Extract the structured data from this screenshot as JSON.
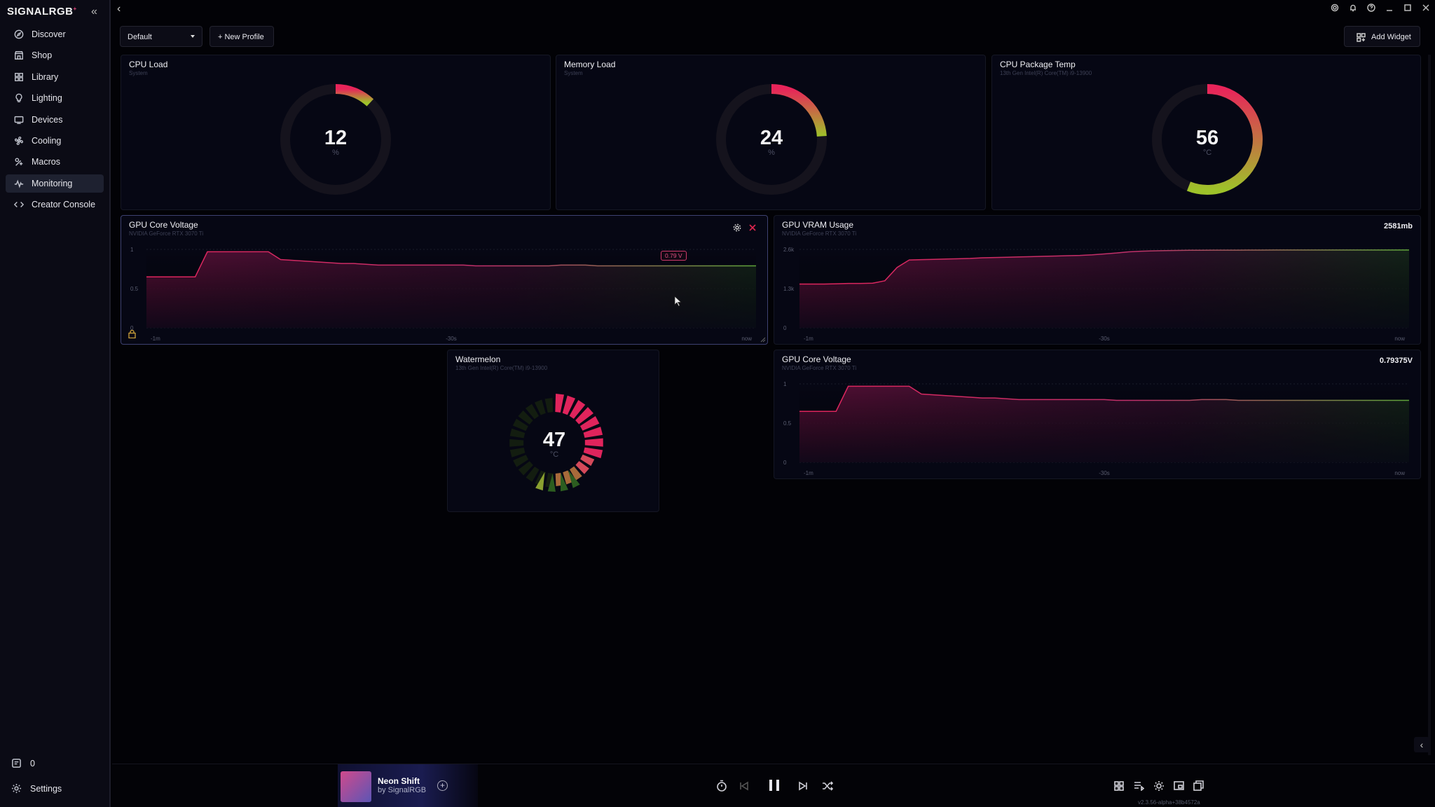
{
  "app": {
    "logo": "SIGNALRGB",
    "nav": [
      {
        "label": "Discover",
        "icon": "compass-icon"
      },
      {
        "label": "Shop",
        "icon": "shop-icon"
      },
      {
        "label": "Library",
        "icon": "library-icon"
      },
      {
        "label": "Lighting",
        "icon": "lightbulb-icon"
      },
      {
        "label": "Devices",
        "icon": "devices-icon"
      },
      {
        "label": "Cooling",
        "icon": "fan-icon"
      },
      {
        "label": "Macros",
        "icon": "macros-icon"
      },
      {
        "label": "Monitoring",
        "icon": "pulse-icon"
      },
      {
        "label": "Creator Console",
        "icon": "code-icon"
      }
    ],
    "active_nav": "Monitoring",
    "notifications_count": "0",
    "settings_label": "Settings"
  },
  "toolbar": {
    "profile": "Default",
    "new_profile": "+ New Profile",
    "add_widget": "Add Widget"
  },
  "widgets": {
    "cpu_load": {
      "title": "CPU Load",
      "subtitle": "System",
      "value": "12",
      "unit": "%",
      "percent": 12,
      "color_from": "#e8245a",
      "color_to": "#9ec22a"
    },
    "memory_load": {
      "title": "Memory Load",
      "subtitle": "System",
      "value": "24",
      "unit": "%",
      "percent": 24,
      "color_from": "#e8245a",
      "color_to": "#9ec22a"
    },
    "cpu_temp": {
      "title": "CPU Package Temp",
      "subtitle": "13th Gen Intel(R) Core(TM) i9-13900",
      "value": "56",
      "unit": "°C",
      "percent": 56,
      "color_from": "#e8245a",
      "color_to": "#9ec22a"
    },
    "gpu_voltage": {
      "title": "GPU Core Voltage",
      "subtitle": "NVIDIA GeForce RTX 3070 Ti",
      "tooltip": "0.79 V",
      "y_ticks": [
        "1",
        "0.5",
        "0"
      ],
      "x_ticks": [
        "-1m",
        "-30s",
        "now"
      ]
    },
    "gpu_vram": {
      "title": "GPU VRAM Usage",
      "subtitle": "NVIDIA GeForce RTX 3070 Ti",
      "value": "2581mb",
      "y_ticks": [
        "2.6k",
        "1.3k",
        "0"
      ],
      "x_ticks": [
        "-1m",
        "-30s",
        "now"
      ]
    },
    "watermelon": {
      "title": "Watermelon",
      "subtitle": "13th Gen Intel(R) Core(TM) i9-13900",
      "value": "47",
      "unit": "°C",
      "percent": 47
    },
    "gpu_voltage2": {
      "title": "GPU Core Voltage",
      "subtitle": "NVIDIA GeForce RTX 3070 Ti",
      "value": "0.79375V",
      "y_ticks": [
        "1",
        "0.5",
        "0"
      ],
      "x_ticks": [
        "-1m",
        "-30s",
        "now"
      ]
    }
  },
  "chart_data": [
    {
      "type": "line",
      "title": "GPU Core Voltage",
      "ylim": [
        0,
        1
      ],
      "x": [
        "-1m",
        "-30s",
        "now"
      ],
      "values": [
        0.65,
        0.65,
        0.65,
        0.65,
        0.65,
        0.97,
        0.97,
        0.97,
        0.97,
        0.97,
        0.97,
        0.87,
        0.86,
        0.85,
        0.84,
        0.83,
        0.82,
        0.82,
        0.81,
        0.8,
        0.8,
        0.8,
        0.8,
        0.8,
        0.8,
        0.8,
        0.8,
        0.79,
        0.79,
        0.79,
        0.79,
        0.79,
        0.79,
        0.79,
        0.8,
        0.8,
        0.8,
        0.79,
        0.79,
        0.79,
        0.79,
        0.79,
        0.79,
        0.79,
        0.79,
        0.79,
        0.79,
        0.79,
        0.79,
        0.79,
        0.79
      ]
    },
    {
      "type": "line",
      "title": "GPU VRAM Usage",
      "ylim": [
        0,
        2600
      ],
      "x": [
        "-1m",
        "-30s",
        "now"
      ],
      "values": [
        1450,
        1450,
        1450,
        1460,
        1470,
        1470,
        1480,
        1560,
        2000,
        2250,
        2260,
        2270,
        2280,
        2290,
        2300,
        2320,
        2330,
        2340,
        2350,
        2360,
        2370,
        2380,
        2390,
        2400,
        2420,
        2450,
        2480,
        2520,
        2540,
        2550,
        2560,
        2565,
        2570,
        2570,
        2575,
        2575,
        2575,
        2578,
        2578,
        2580,
        2580,
        2580,
        2580,
        2580,
        2581,
        2581,
        2581,
        2581,
        2581,
        2581,
        2581
      ]
    },
    {
      "type": "line",
      "title": "GPU Core Voltage",
      "ylim": [
        0,
        1
      ],
      "x": [
        "-1m",
        "-30s",
        "now"
      ],
      "values": [
        0.65,
        0.65,
        0.65,
        0.65,
        0.97,
        0.97,
        0.97,
        0.97,
        0.97,
        0.97,
        0.87,
        0.86,
        0.85,
        0.84,
        0.83,
        0.82,
        0.82,
        0.81,
        0.8,
        0.8,
        0.8,
        0.8,
        0.8,
        0.8,
        0.8,
        0.8,
        0.79,
        0.79,
        0.79,
        0.79,
        0.79,
        0.79,
        0.79,
        0.8,
        0.8,
        0.8,
        0.79,
        0.79,
        0.79,
        0.79,
        0.79,
        0.79,
        0.79,
        0.79,
        0.79,
        0.79,
        0.79,
        0.79,
        0.79,
        0.79,
        0.79
      ]
    }
  ],
  "player": {
    "track_name": "Neon Shift",
    "track_by": "by SignalRGB",
    "version": "v2.3.56-alpha+38b4572a"
  }
}
